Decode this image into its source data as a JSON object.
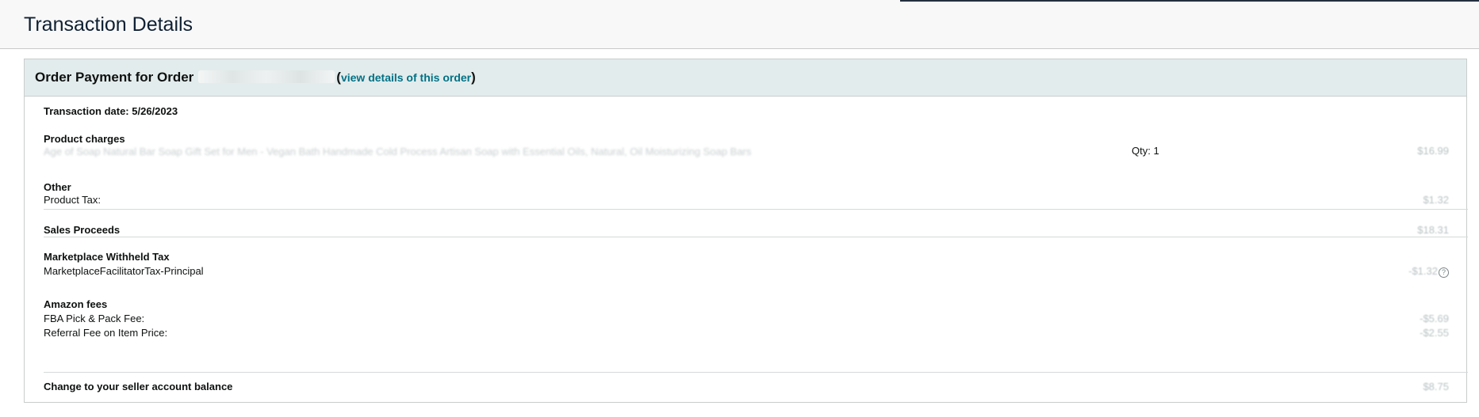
{
  "header": {
    "title": "Transaction Details"
  },
  "panel": {
    "title_prefix": "Order Payment for Order",
    "link_text": "view details of this order",
    "paren_open": "(",
    "paren_close": ")"
  },
  "transaction_date": "Transaction date: 5/26/2023",
  "product_charges": {
    "label": "Product charges",
    "item_description": "Age of Soap Natural Bar Soap Gift Set for Men - Vegan Bath Handmade Cold Process Artisan Soap with Essential Oils, Natural, Oil Moisturizing Soap Bars",
    "qty": "Qty: 1",
    "amount": "$16.99"
  },
  "other": {
    "label": "Other",
    "product_tax_label": "Product Tax:",
    "product_tax_amount": "$1.32"
  },
  "sales_proceeds": {
    "label": "Sales Proceeds",
    "amount": "$18.31"
  },
  "marketplace_withheld_tax": {
    "label": "Marketplace Withheld Tax",
    "item_label": "MarketplaceFacilitatorTax-Principal",
    "amount": "-$1.32"
  },
  "amazon_fees": {
    "label": "Amazon fees",
    "fba_label": "FBA Pick & Pack Fee:",
    "fba_amount": "-$5.69",
    "referral_label": "Referral Fee on Item Price:",
    "referral_amount": "-$2.55"
  },
  "balance_change": {
    "label": "Change to your seller account balance",
    "amount": "$8.75"
  },
  "icons": {
    "help": "question-circle-icon"
  },
  "colors": {
    "link": "#007185",
    "panel_header_bg": "#e3ecec",
    "title_color": "#0f2033"
  }
}
